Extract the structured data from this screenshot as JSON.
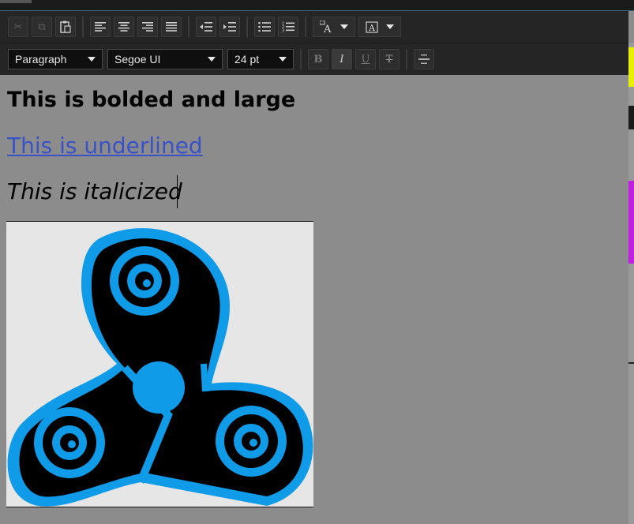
{
  "toolbar": {
    "icons": {
      "cut": "scissors-icon",
      "copy": "copy-icon",
      "paste": "clipboard-icon",
      "align_left": "align-left-icon",
      "align_center": "align-center-icon",
      "align_right": "align-right-icon",
      "justify": "justify-icon",
      "outdent": "outdent-icon",
      "indent": "indent-icon",
      "bullets": "bulleted-list-icon",
      "numbering": "numbered-list-icon",
      "text_color": "font-color-icon",
      "highlight": "highlight-color-icon"
    },
    "style_select": "Paragraph",
    "font_select": "Segoe UI",
    "size_select": "24 pt",
    "bold_label": "B",
    "italic_label": "I",
    "underline_label": "U",
    "strike_label": "T"
  },
  "editor": {
    "line1": "This is bolded and large",
    "line2": "This is underlined",
    "line3": "This is italicized",
    "image": "triskelion-image"
  },
  "colors": {
    "toolbar_bg": "#252526",
    "editor_bg": "#8c8c8c",
    "link_color": "#3a52c8",
    "triskelion_blue": "#0f9be8"
  }
}
